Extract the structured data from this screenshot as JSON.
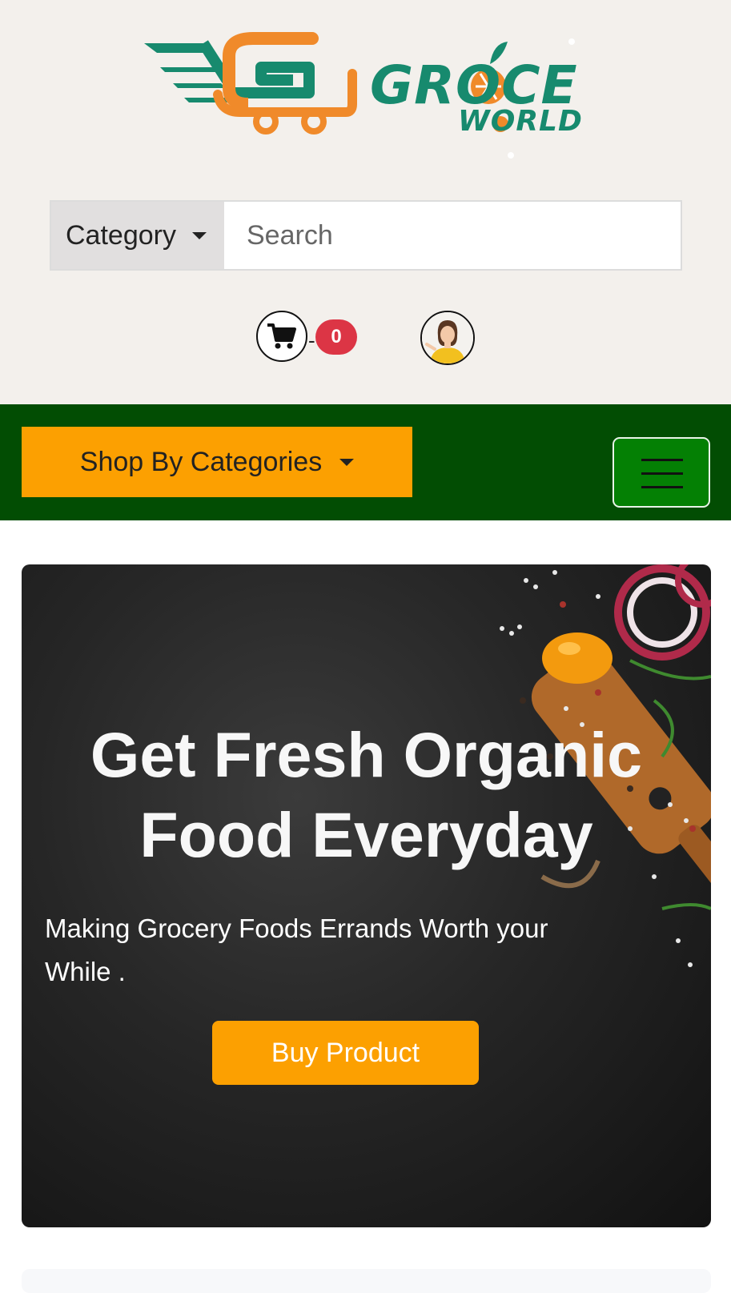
{
  "header": {
    "logo": {
      "word_top": "GROCE",
      "word_bottom": "WORLD",
      "alt": "Groce World logo"
    },
    "search": {
      "category_label": "Category",
      "placeholder": "Search",
      "value": ""
    },
    "cart": {
      "separator": "-",
      "count": "0"
    },
    "profile": {
      "icon": "user-avatar"
    }
  },
  "nav": {
    "shop_label": "Shop By Categories",
    "menu_icon": "hamburger-icon"
  },
  "hero": {
    "title": "Get Fresh Organic Food Everyday",
    "subtitle": "Making Grocery Foods Errands Worth your While .",
    "button_label": "Buy Product"
  },
  "colors": {
    "header_bg": "#f3f0ec",
    "nav_bg": "#024d03",
    "accent": "#fca001",
    "brand_green": "#178a6e",
    "brand_orange": "#f08a2a",
    "badge": "#dc3545"
  }
}
